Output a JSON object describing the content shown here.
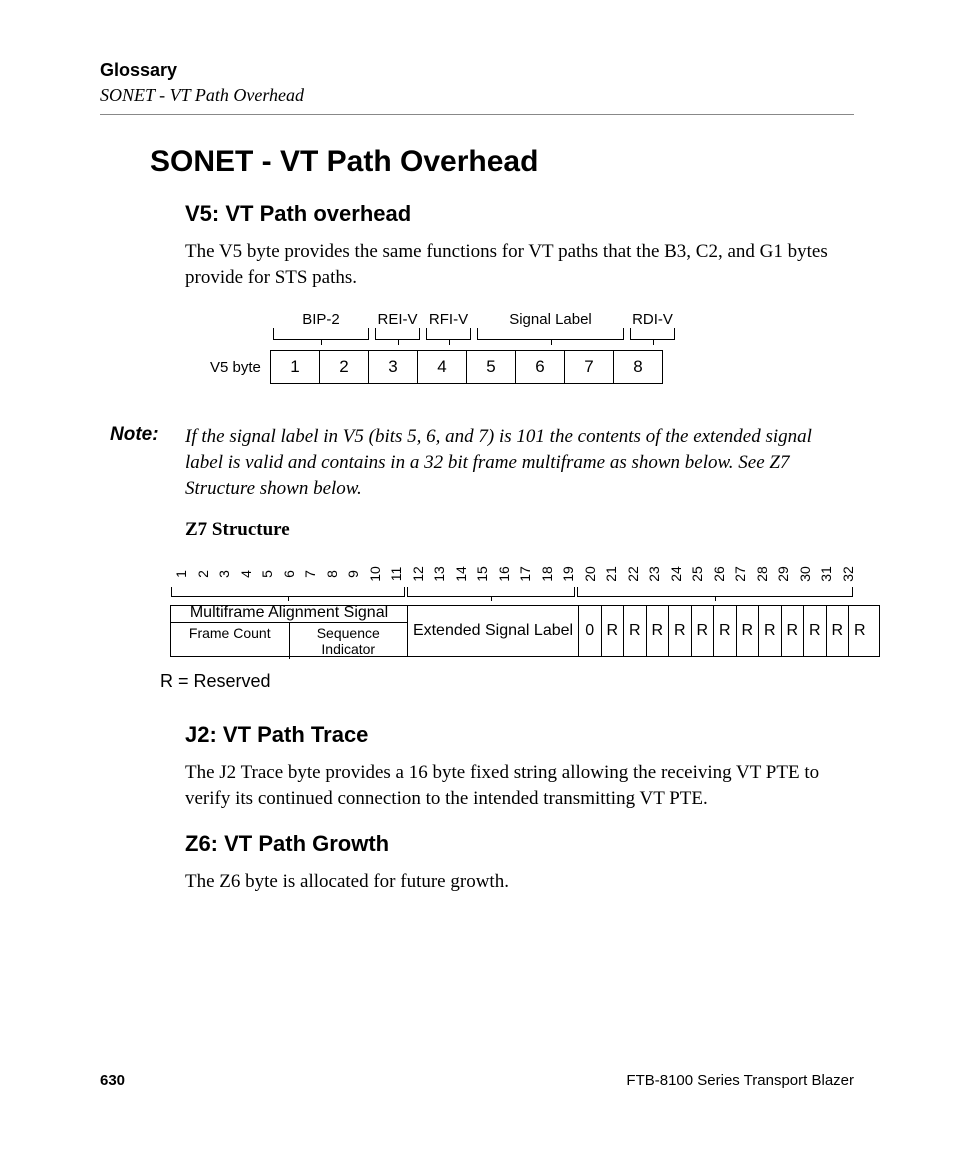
{
  "header": {
    "glossary": "Glossary",
    "subhead": "SONET - VT Path Overhead"
  },
  "title": "SONET - VT Path Overhead",
  "v5": {
    "heading": "V5: VT Path overhead",
    "body": "The V5 byte provides the same functions for VT paths that the B3, C2, and G1 bytes provide for STS paths.",
    "row_label": "V5 byte",
    "labels": {
      "bip2": "BIP-2",
      "reiv": "REI-V",
      "rfiv": "RFI-V",
      "signal": "Signal Label",
      "rdiv": "RDI-V"
    },
    "bits": [
      "1",
      "2",
      "3",
      "4",
      "5",
      "6",
      "7",
      "8"
    ]
  },
  "note": {
    "label": "Note:",
    "body": "If the signal label in V5 (bits 5, 6, and 7) is 101 the contents of the extended signal label is valid and contains in a 32 bit frame multiframe as shown below. See Z7 Structure shown below."
  },
  "z7": {
    "title": "Z7 Structure",
    "nums": [
      "1",
      "2",
      "3",
      "4",
      "5",
      "6",
      "7",
      "8",
      "9",
      "10",
      "11",
      "12",
      "13",
      "14",
      "15",
      "16",
      "17",
      "18",
      "19",
      "20",
      "21",
      "22",
      "23",
      "24",
      "25",
      "26",
      "27",
      "28",
      "29",
      "30",
      "31",
      "32"
    ],
    "mas": "Multiframe Alignment Signal",
    "frame_count": "Frame Count",
    "seq_ind": "Sequence Indicator",
    "ext_label": "Extended Signal Label",
    "zero": "0",
    "r": "R",
    "reserved": "R = Reserved"
  },
  "j2": {
    "heading": "J2: VT Path Trace",
    "body": "The J2 Trace byte provides a 16 byte fixed string allowing the receiving VT PTE to verify its continued connection to the intended transmitting VT PTE."
  },
  "z6": {
    "heading": "Z6: VT Path Growth",
    "body": "The Z6 byte is allocated for future growth."
  },
  "footer": {
    "page": "630",
    "product": "FTB-8100 Series Transport Blazer"
  },
  "chart_data": [
    {
      "type": "table",
      "title": "V5 byte bit layout",
      "bits": [
        1,
        2,
        3,
        4,
        5,
        6,
        7,
        8
      ],
      "fields": [
        {
          "name": "BIP-2",
          "bits": [
            1,
            2
          ]
        },
        {
          "name": "REI-V",
          "bits": [
            3
          ]
        },
        {
          "name": "RFI-V",
          "bits": [
            4
          ]
        },
        {
          "name": "Signal Label",
          "bits": [
            5,
            6,
            7
          ]
        },
        {
          "name": "RDI-V",
          "bits": [
            8
          ]
        }
      ]
    },
    {
      "type": "table",
      "title": "Z7 Structure (32-bit multiframe)",
      "bits": [
        1,
        2,
        3,
        4,
        5,
        6,
        7,
        8,
        9,
        10,
        11,
        12,
        13,
        14,
        15,
        16,
        17,
        18,
        19,
        20,
        21,
        22,
        23,
        24,
        25,
        26,
        27,
        28,
        29,
        30,
        31,
        32
      ],
      "fields": [
        {
          "name": "Multiframe Alignment Signal",
          "bits": [
            1,
            2,
            3,
            4,
            5,
            6,
            7,
            8,
            9,
            10,
            11
          ],
          "subfields": [
            {
              "name": "Frame Count"
            },
            {
              "name": "Sequence Indicator"
            }
          ]
        },
        {
          "name": "Extended Signal Label",
          "bits": [
            12,
            13,
            14,
            15,
            16,
            17,
            18,
            19
          ]
        },
        {
          "name": "0",
          "bits": [
            20
          ]
        },
        {
          "name": "R",
          "bits": [
            21
          ]
        },
        {
          "name": "R",
          "bits": [
            22
          ]
        },
        {
          "name": "R",
          "bits": [
            23
          ]
        },
        {
          "name": "R",
          "bits": [
            24
          ]
        },
        {
          "name": "R",
          "bits": [
            25
          ]
        },
        {
          "name": "R",
          "bits": [
            26
          ]
        },
        {
          "name": "R",
          "bits": [
            27
          ]
        },
        {
          "name": "R",
          "bits": [
            28
          ]
        },
        {
          "name": "R",
          "bits": [
            29
          ]
        },
        {
          "name": "R",
          "bits": [
            30
          ]
        },
        {
          "name": "R",
          "bits": [
            31
          ]
        },
        {
          "name": "R",
          "bits": [
            32
          ]
        }
      ],
      "legend": "R = Reserved"
    }
  ]
}
